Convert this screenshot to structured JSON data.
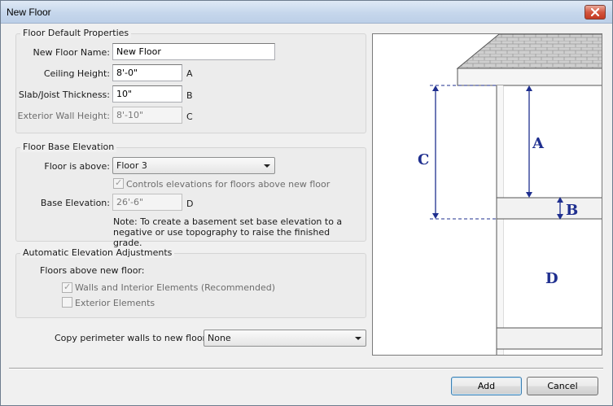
{
  "window": {
    "title": "New Floor"
  },
  "floor_default": {
    "legend": "Floor Default Properties",
    "name_label": "New Floor Name:",
    "name_value": "New Floor",
    "ceiling_label": "Ceiling Height:",
    "ceiling_value": "8'-0\"",
    "ceiling_letter": "A",
    "slab_label": "Slab/Joist Thickness:",
    "slab_value": "10\"",
    "slab_letter": "B",
    "ext_wall_label": "Exterior Wall Height:",
    "ext_wall_value": "8'-10\"",
    "ext_wall_letter": "C"
  },
  "base_elevation": {
    "legend": "Floor Base Elevation",
    "floor_above_label": "Floor is above:",
    "floor_above_value": "Floor 3",
    "controls_label": "Controls elevations for floors above new floor",
    "controls_checked": true,
    "base_label": "Base Elevation:",
    "base_value": "26'-6\"",
    "base_letter": "D",
    "note": "Note: To create a basement set base elevation to a negative or use topography to raise the finished grade."
  },
  "auto_adjust": {
    "legend": "Automatic Elevation Adjustments",
    "sub_label": "Floors above new floor:",
    "walls_label": "Walls and Interior Elements (Recommended)",
    "walls_checked": true,
    "exterior_label": "Exterior Elements",
    "exterior_checked": false
  },
  "copy_walls": {
    "label": "Copy perimeter walls to new floor from:",
    "value": "None"
  },
  "diagram": {
    "label_a": "A",
    "label_b": "B",
    "label_c": "C",
    "label_d": "D",
    "accent_color": "#1f2f8f"
  },
  "buttons": {
    "add": "Add",
    "cancel": "Cancel"
  }
}
